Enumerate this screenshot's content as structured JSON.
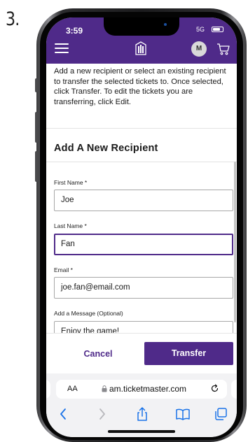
{
  "step_number": "3.",
  "status_bar": {
    "time": "3:59",
    "network": "5G"
  },
  "header": {
    "avatar_initial": "M"
  },
  "intro_text": "Add a new recipient or select an existing recipient to transfer the selected tickets to. Once selected, click Transfer. To edit the tickets you are transferring, click Edit.",
  "section_title": "Add A New Recipient",
  "fields": {
    "first_name": {
      "label": "First Name *",
      "value": "Joe"
    },
    "last_name": {
      "label": "Last Name *",
      "value": "Fan"
    },
    "email": {
      "label": "Email *",
      "value": "joe.fan@email.com"
    },
    "message": {
      "label": "Add a Message (Optional)",
      "value": "Enjoy the game!"
    }
  },
  "actions": {
    "cancel_label": "Cancel",
    "transfer_label": "Transfer"
  },
  "browser": {
    "text_size_label": "AA",
    "url": "am.ticketmaster.com"
  },
  "colors": {
    "brand": "#4f2a89",
    "border": "#a8a8a8"
  },
  "icons": [
    "hamburger-menu-icon",
    "ticketmaster-logo-icon",
    "cart-icon",
    "lock-icon",
    "reload-icon",
    "back-icon",
    "forward-icon",
    "share-icon",
    "bookmarks-icon",
    "tabs-icon"
  ]
}
